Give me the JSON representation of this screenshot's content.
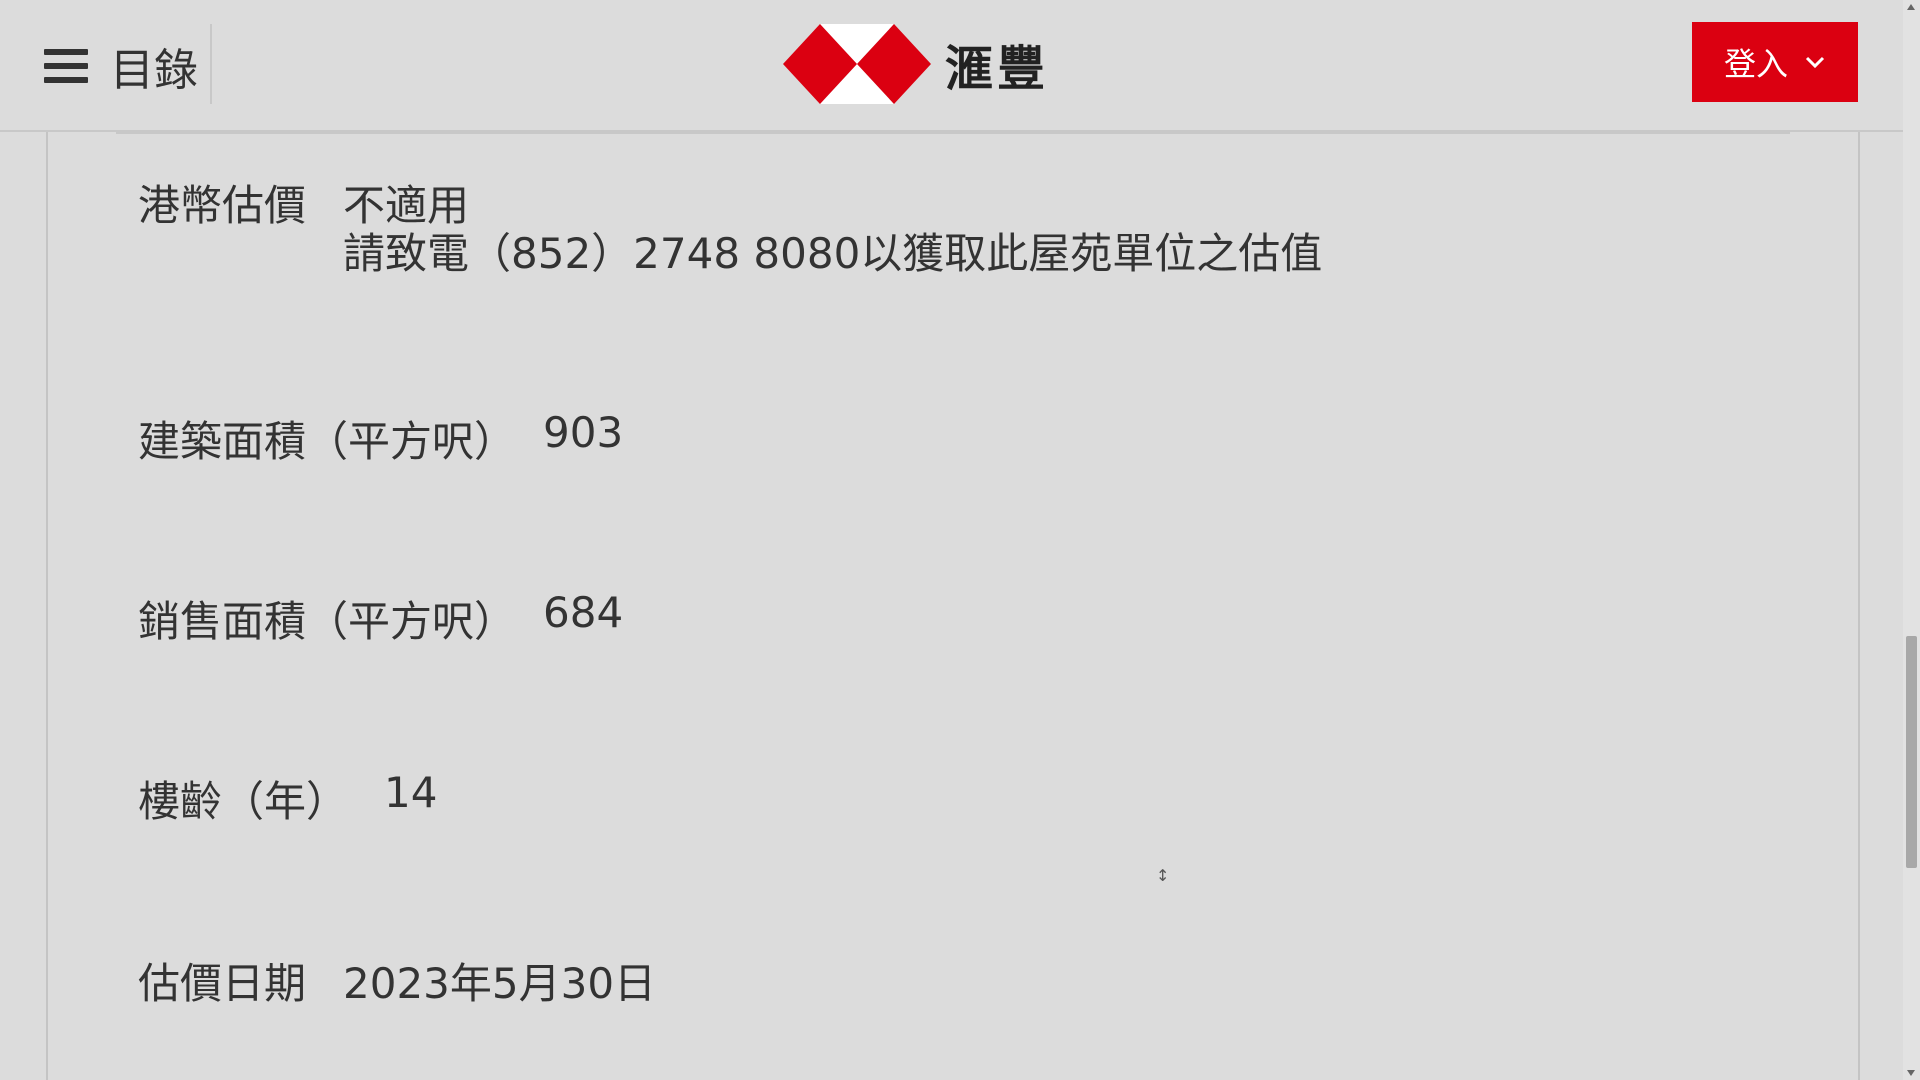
{
  "header": {
    "menu_label": "目錄",
    "brand_name": "滙豐",
    "login_label": "登入",
    "brand_color": "#db0011"
  },
  "details": [
    {
      "label": "港幣估價",
      "value_lines": [
        "不適用",
        "請致電（852）2748 8080以獲取此屋苑單位之估值"
      ]
    },
    {
      "label": "建築面積（平方呎）",
      "value": "903"
    },
    {
      "label": "銷售面積（平方呎）",
      "value": "684"
    },
    {
      "label": "樓齡（年）",
      "value": "14"
    },
    {
      "label": "估價日期",
      "value": "2023年5月30日"
    }
  ],
  "icons": {
    "menu": "hamburger-icon",
    "logo": "hexagon-logo-icon",
    "login_dropdown": "chevron-down-icon"
  }
}
